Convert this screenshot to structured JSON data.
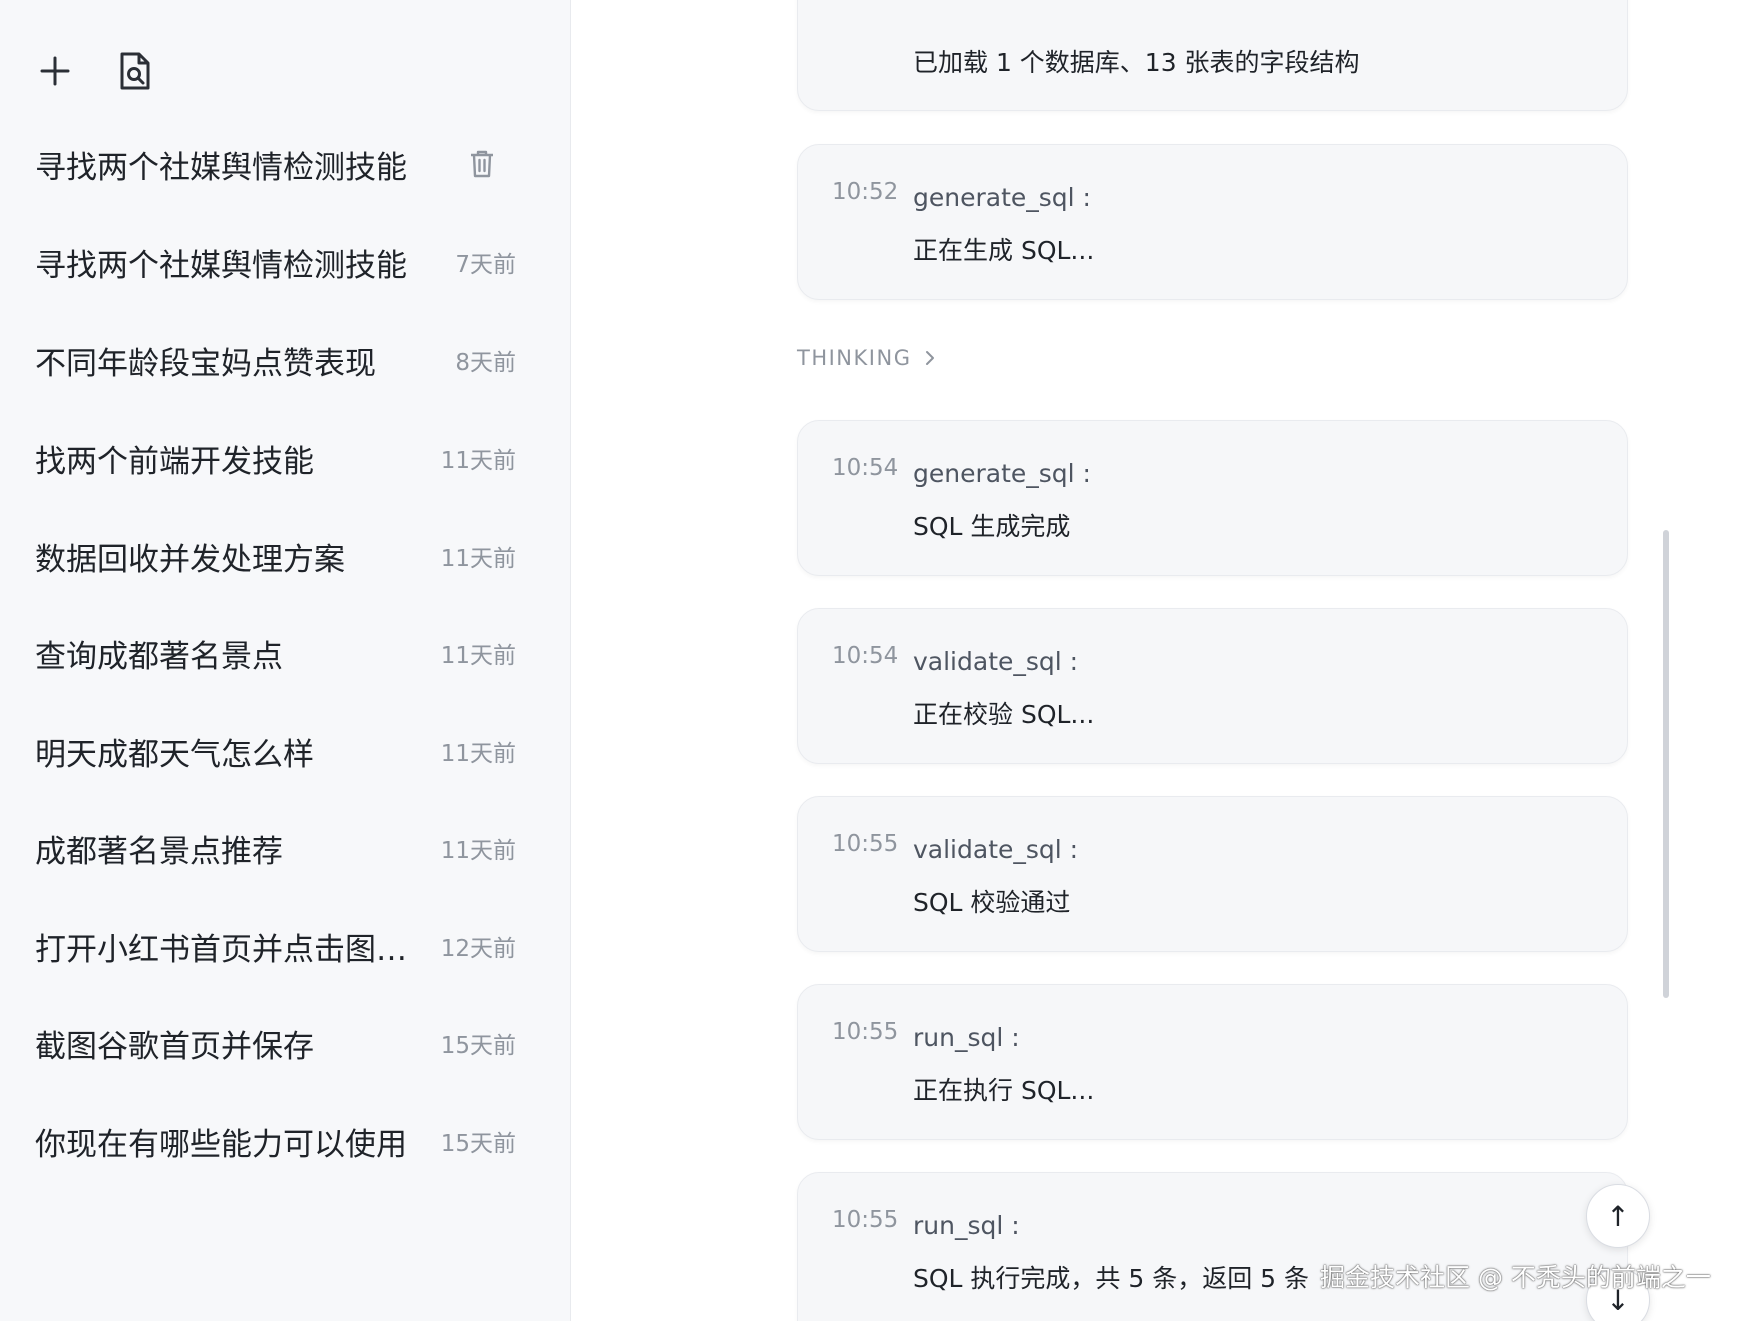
{
  "sidebar": {
    "history": [
      {
        "title": "寻找两个社媒舆情检测技能",
        "time": ""
      },
      {
        "title": "寻找两个社媒舆情检测技能",
        "time": "7天前"
      },
      {
        "title": "不同年龄段宝妈点赞表现",
        "time": "8天前"
      },
      {
        "title": "找两个前端开发技能",
        "time": "11天前"
      },
      {
        "title": "数据回收并发处理方案",
        "time": "11天前"
      },
      {
        "title": "查询成都著名景点",
        "time": "11天前"
      },
      {
        "title": "明天成都天气怎么样",
        "time": "11天前"
      },
      {
        "title": "成都著名景点推荐",
        "time": "11天前"
      },
      {
        "title": "打开小红书首页并点击图文...",
        "time": "12天前"
      },
      {
        "title": "截图谷歌首页并保存",
        "time": "15天前"
      },
      {
        "title": "你现在有哪些能力可以使用",
        "time": "15天前"
      }
    ]
  },
  "main": {
    "top_card": {
      "message": "已加载 1 个数据库、13 张表的字段结构"
    },
    "thinking_label": "THINKING",
    "steps": [
      {
        "time": "10:52",
        "name": "generate_sql :",
        "message": "正在生成 SQL..."
      },
      {
        "time": "10:54",
        "name": "generate_sql :",
        "message": "SQL 生成完成"
      },
      {
        "time": "10:54",
        "name": "validate_sql :",
        "message": "正在校验 SQL..."
      },
      {
        "time": "10:55",
        "name": "validate_sql :",
        "message": "SQL 校验通过"
      },
      {
        "time": "10:55",
        "name": "run_sql :",
        "message": "正在执行 SQL..."
      },
      {
        "time": "10:55",
        "name": "run_sql :",
        "message": "SQL 执行完成，共 5 条，返回 5 条"
      }
    ],
    "scroll_up_label": "↑",
    "scroll_down_label": "↓"
  },
  "watermark": "掘金技术社区 @ 不秃头的前端之一",
  "icons": {
    "new": "plus-icon",
    "search_doc": "document-search-icon",
    "delete": "trash-icon",
    "thinking": "chevron-right-icon"
  }
}
